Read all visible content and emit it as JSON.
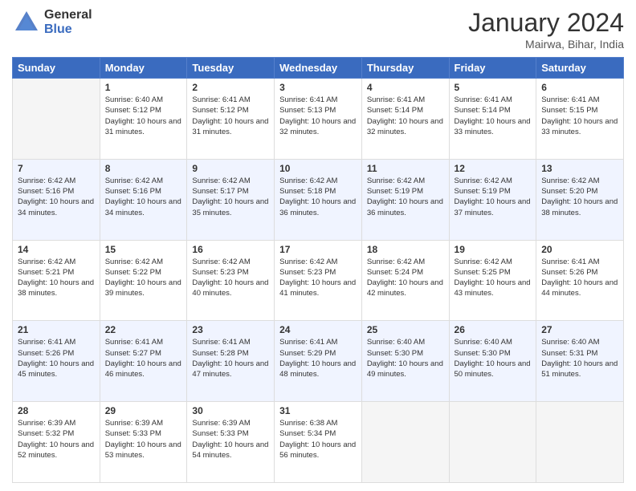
{
  "header": {
    "logo_general": "General",
    "logo_blue": "Blue",
    "month_year": "January 2024",
    "subtitle": "Mairwa, Bihar, India"
  },
  "days_of_week": [
    "Sunday",
    "Monday",
    "Tuesday",
    "Wednesday",
    "Thursday",
    "Friday",
    "Saturday"
  ],
  "weeks": [
    {
      "days": [
        {
          "num": "",
          "empty": true
        },
        {
          "num": "1",
          "sunrise": "Sunrise: 6:40 AM",
          "sunset": "Sunset: 5:12 PM",
          "daylight": "Daylight: 10 hours and 31 minutes."
        },
        {
          "num": "2",
          "sunrise": "Sunrise: 6:41 AM",
          "sunset": "Sunset: 5:12 PM",
          "daylight": "Daylight: 10 hours and 31 minutes."
        },
        {
          "num": "3",
          "sunrise": "Sunrise: 6:41 AM",
          "sunset": "Sunset: 5:13 PM",
          "daylight": "Daylight: 10 hours and 32 minutes."
        },
        {
          "num": "4",
          "sunrise": "Sunrise: 6:41 AM",
          "sunset": "Sunset: 5:14 PM",
          "daylight": "Daylight: 10 hours and 32 minutes."
        },
        {
          "num": "5",
          "sunrise": "Sunrise: 6:41 AM",
          "sunset": "Sunset: 5:14 PM",
          "daylight": "Daylight: 10 hours and 33 minutes."
        },
        {
          "num": "6",
          "sunrise": "Sunrise: 6:41 AM",
          "sunset": "Sunset: 5:15 PM",
          "daylight": "Daylight: 10 hours and 33 minutes."
        }
      ]
    },
    {
      "days": [
        {
          "num": "7",
          "sunrise": "Sunrise: 6:42 AM",
          "sunset": "Sunset: 5:16 PM",
          "daylight": "Daylight: 10 hours and 34 minutes."
        },
        {
          "num": "8",
          "sunrise": "Sunrise: 6:42 AM",
          "sunset": "Sunset: 5:16 PM",
          "daylight": "Daylight: 10 hours and 34 minutes."
        },
        {
          "num": "9",
          "sunrise": "Sunrise: 6:42 AM",
          "sunset": "Sunset: 5:17 PM",
          "daylight": "Daylight: 10 hours and 35 minutes."
        },
        {
          "num": "10",
          "sunrise": "Sunrise: 6:42 AM",
          "sunset": "Sunset: 5:18 PM",
          "daylight": "Daylight: 10 hours and 36 minutes."
        },
        {
          "num": "11",
          "sunrise": "Sunrise: 6:42 AM",
          "sunset": "Sunset: 5:19 PM",
          "daylight": "Daylight: 10 hours and 36 minutes."
        },
        {
          "num": "12",
          "sunrise": "Sunrise: 6:42 AM",
          "sunset": "Sunset: 5:19 PM",
          "daylight": "Daylight: 10 hours and 37 minutes."
        },
        {
          "num": "13",
          "sunrise": "Sunrise: 6:42 AM",
          "sunset": "Sunset: 5:20 PM",
          "daylight": "Daylight: 10 hours and 38 minutes."
        }
      ]
    },
    {
      "days": [
        {
          "num": "14",
          "sunrise": "Sunrise: 6:42 AM",
          "sunset": "Sunset: 5:21 PM",
          "daylight": "Daylight: 10 hours and 38 minutes."
        },
        {
          "num": "15",
          "sunrise": "Sunrise: 6:42 AM",
          "sunset": "Sunset: 5:22 PM",
          "daylight": "Daylight: 10 hours and 39 minutes."
        },
        {
          "num": "16",
          "sunrise": "Sunrise: 6:42 AM",
          "sunset": "Sunset: 5:23 PM",
          "daylight": "Daylight: 10 hours and 40 minutes."
        },
        {
          "num": "17",
          "sunrise": "Sunrise: 6:42 AM",
          "sunset": "Sunset: 5:23 PM",
          "daylight": "Daylight: 10 hours and 41 minutes."
        },
        {
          "num": "18",
          "sunrise": "Sunrise: 6:42 AM",
          "sunset": "Sunset: 5:24 PM",
          "daylight": "Daylight: 10 hours and 42 minutes."
        },
        {
          "num": "19",
          "sunrise": "Sunrise: 6:42 AM",
          "sunset": "Sunset: 5:25 PM",
          "daylight": "Daylight: 10 hours and 43 minutes."
        },
        {
          "num": "20",
          "sunrise": "Sunrise: 6:41 AM",
          "sunset": "Sunset: 5:26 PM",
          "daylight": "Daylight: 10 hours and 44 minutes."
        }
      ]
    },
    {
      "days": [
        {
          "num": "21",
          "sunrise": "Sunrise: 6:41 AM",
          "sunset": "Sunset: 5:26 PM",
          "daylight": "Daylight: 10 hours and 45 minutes."
        },
        {
          "num": "22",
          "sunrise": "Sunrise: 6:41 AM",
          "sunset": "Sunset: 5:27 PM",
          "daylight": "Daylight: 10 hours and 46 minutes."
        },
        {
          "num": "23",
          "sunrise": "Sunrise: 6:41 AM",
          "sunset": "Sunset: 5:28 PM",
          "daylight": "Daylight: 10 hours and 47 minutes."
        },
        {
          "num": "24",
          "sunrise": "Sunrise: 6:41 AM",
          "sunset": "Sunset: 5:29 PM",
          "daylight": "Daylight: 10 hours and 48 minutes."
        },
        {
          "num": "25",
          "sunrise": "Sunrise: 6:40 AM",
          "sunset": "Sunset: 5:30 PM",
          "daylight": "Daylight: 10 hours and 49 minutes."
        },
        {
          "num": "26",
          "sunrise": "Sunrise: 6:40 AM",
          "sunset": "Sunset: 5:30 PM",
          "daylight": "Daylight: 10 hours and 50 minutes."
        },
        {
          "num": "27",
          "sunrise": "Sunrise: 6:40 AM",
          "sunset": "Sunset: 5:31 PM",
          "daylight": "Daylight: 10 hours and 51 minutes."
        }
      ]
    },
    {
      "days": [
        {
          "num": "28",
          "sunrise": "Sunrise: 6:39 AM",
          "sunset": "Sunset: 5:32 PM",
          "daylight": "Daylight: 10 hours and 52 minutes."
        },
        {
          "num": "29",
          "sunrise": "Sunrise: 6:39 AM",
          "sunset": "Sunset: 5:33 PM",
          "daylight": "Daylight: 10 hours and 53 minutes."
        },
        {
          "num": "30",
          "sunrise": "Sunrise: 6:39 AM",
          "sunset": "Sunset: 5:33 PM",
          "daylight": "Daylight: 10 hours and 54 minutes."
        },
        {
          "num": "31",
          "sunrise": "Sunrise: 6:38 AM",
          "sunset": "Sunset: 5:34 PM",
          "daylight": "Daylight: 10 hours and 56 minutes."
        },
        {
          "num": "",
          "empty": true
        },
        {
          "num": "",
          "empty": true
        },
        {
          "num": "",
          "empty": true
        }
      ]
    }
  ]
}
